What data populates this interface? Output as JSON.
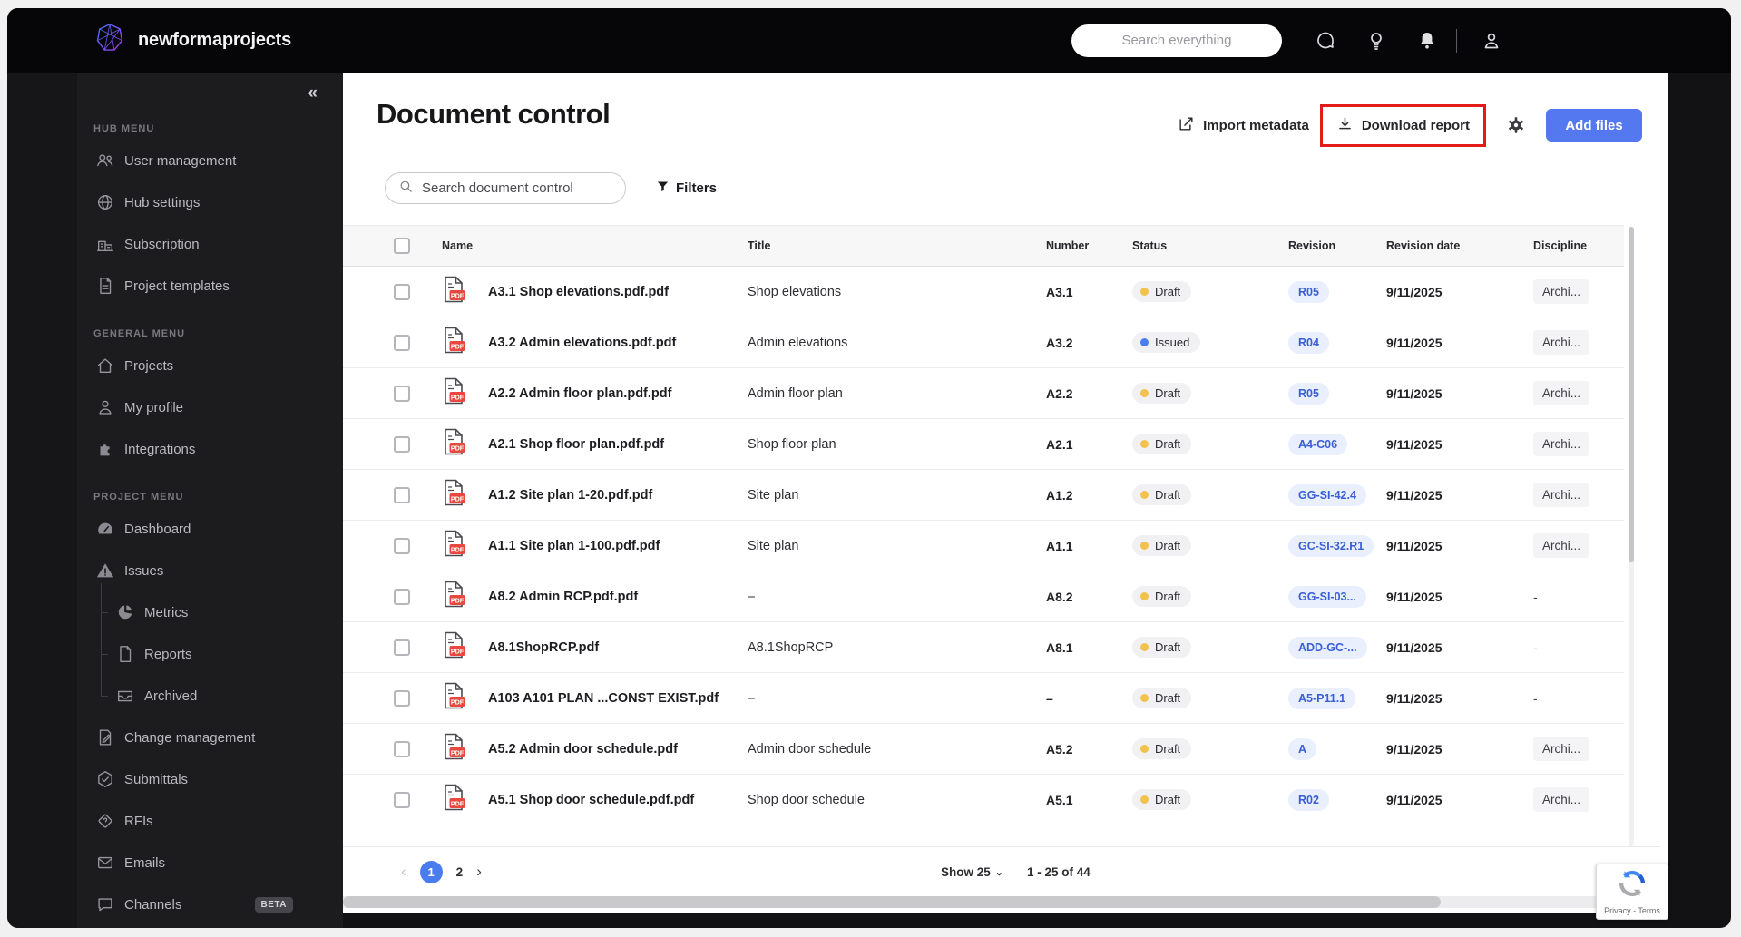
{
  "colors": {
    "accent_blue": "#4A7CF0",
    "add_files_blue": "#5478F0",
    "status_draft": "#F2C14E",
    "status_issued": "#4A7DF0",
    "annotation_red": "#E31B18",
    "revision_text": "#3A5ED6",
    "revision_bg": "#E9EFFC",
    "pdf_badge_red": "#E8483F"
  },
  "header": {
    "brand": "newformaprojects",
    "search_placeholder": "Search everything"
  },
  "sidebar": {
    "collapse_icon": "«",
    "sections": [
      {
        "label": "HUB MENU",
        "items": [
          {
            "label": "User management"
          },
          {
            "label": "Hub settings"
          },
          {
            "label": "Subscription"
          },
          {
            "label": "Project templates"
          }
        ]
      },
      {
        "label": "GENERAL MENU",
        "items": [
          {
            "label": "Projects"
          },
          {
            "label": "My profile"
          },
          {
            "label": "Integrations"
          }
        ]
      },
      {
        "label": "PROJECT MENU",
        "items": [
          {
            "label": "Dashboard"
          },
          {
            "label": "Issues"
          },
          {
            "label": "Metrics"
          },
          {
            "label": "Reports"
          },
          {
            "label": "Archived"
          },
          {
            "label": "Change management"
          },
          {
            "label": "Submittals"
          },
          {
            "label": "RFIs"
          },
          {
            "label": "Emails"
          },
          {
            "label": "Channels",
            "badge": "BETA"
          }
        ]
      }
    ]
  },
  "main": {
    "title": "Document control",
    "actions": {
      "import_label": "Import metadata",
      "download_label": "Download report",
      "add_files_label": "Add files"
    },
    "search_placeholder": "Search document control",
    "filters_label": "Filters"
  },
  "table": {
    "headers": [
      "Name",
      "Title",
      "Number",
      "Status",
      "Revision",
      "Revision date",
      "Discipline"
    ],
    "rows": [
      {
        "name": "A3.1 Shop elevations.pdf.pdf",
        "title": "Shop elevations",
        "number": "A3.1",
        "status": "Draft",
        "status_color": "#F2C14E",
        "revision": "R05",
        "revision_date": "9/11/2025",
        "discipline": "Archi...",
        "discipline_class": "disc-box"
      },
      {
        "name": "A3.2 Admin elevations.pdf.pdf",
        "title": "Admin elevations",
        "number": "A3.2",
        "status": "Issued",
        "status_color": "#4A7DF0",
        "revision": "R04",
        "revision_date": "9/11/2025",
        "discipline": "Archi...",
        "discipline_class": "disc-box"
      },
      {
        "name": "A2.2 Admin floor plan.pdf.pdf",
        "title": "Admin floor plan",
        "number": "A2.2",
        "status": "Draft",
        "status_color": "#F2C14E",
        "revision": "R05",
        "revision_date": "9/11/2025",
        "discipline": "Archi...",
        "discipline_class": "disc-box"
      },
      {
        "name": "A2.1 Shop floor plan.pdf.pdf",
        "title": "Shop floor plan",
        "number": "A2.1",
        "status": "Draft",
        "status_color": "#F2C14E",
        "revision": "A4-C06",
        "revision_date": "9/11/2025",
        "discipline": "Archi...",
        "discipline_class": "disc-box"
      },
      {
        "name": "A1.2 Site plan 1-20.pdf.pdf",
        "title": "Site plan",
        "number": "A1.2",
        "status": "Draft",
        "status_color": "#F2C14E",
        "revision": "GG-SI-42.4",
        "revision_date": "9/11/2025",
        "discipline": "Archi...",
        "discipline_class": "disc-box"
      },
      {
        "name": "A1.1 Site plan 1-100.pdf.pdf",
        "title": "Site plan",
        "number": "A1.1",
        "status": "Draft",
        "status_color": "#F2C14E",
        "revision": "GC-SI-32.R1",
        "revision_date": "9/11/2025",
        "discipline": "Archi...",
        "discipline_class": "disc-box"
      },
      {
        "name": "A8.2 Admin RCP.pdf.pdf",
        "title": "–",
        "number": "A8.2",
        "status": "Draft",
        "status_color": "#F2C14E",
        "revision": "GG-SI-03...",
        "revision_date": "9/11/2025",
        "discipline": "-",
        "discipline_class": "disc-plain"
      },
      {
        "name": "A8.1ShopRCP.pdf",
        "title": "A8.1ShopRCP",
        "number": "A8.1",
        "status": "Draft",
        "status_color": "#F2C14E",
        "revision": "ADD-GC-...",
        "revision_date": "9/11/2025",
        "discipline": "-",
        "discipline_class": "disc-plain"
      },
      {
        "name": "A103 A101 PLAN ...CONST EXIST.pdf",
        "title": "–",
        "number": "–",
        "status": "Draft",
        "status_color": "#F2C14E",
        "revision": "A5-P11.1",
        "revision_date": "9/11/2025",
        "discipline": "-",
        "discipline_class": "disc-plain"
      },
      {
        "name": "A5.2 Admin door schedule.pdf",
        "title": "Admin door schedule",
        "number": "A5.2",
        "status": "Draft",
        "status_color": "#F2C14E",
        "revision": "A",
        "revision_date": "9/11/2025",
        "discipline": "Archi...",
        "discipline_class": "disc-box"
      },
      {
        "name": "A5.1 Shop door schedule.pdf.pdf",
        "title": "Shop door schedule",
        "number": "A5.1",
        "status": "Draft",
        "status_color": "#F2C14E",
        "revision": "R02",
        "revision_date": "9/11/2025",
        "discipline": "Archi...",
        "discipline_class": "disc-box"
      }
    ]
  },
  "pagination": {
    "prev": "‹",
    "page1": "1",
    "page2": "2",
    "next": "›",
    "show_label": "Show 25",
    "show_caret": "⌄",
    "range": "1 - 25 of 44"
  },
  "recaptcha": {
    "label": "Privacy - Terms"
  }
}
